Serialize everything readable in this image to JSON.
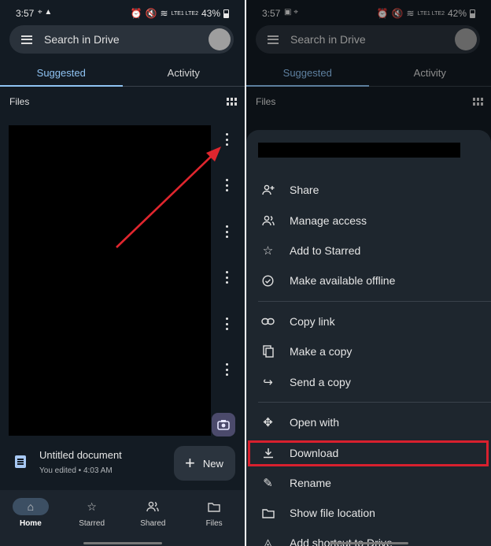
{
  "left": {
    "status": {
      "time": "3:57",
      "battery": "43%",
      "signal_text": "LTE1 LTE2"
    },
    "search": {
      "placeholder": "Search in Drive"
    },
    "tabs": [
      {
        "label": "Suggested",
        "active": true
      },
      {
        "label": "Activity",
        "active": false
      }
    ],
    "files_label": "Files",
    "recent_doc": {
      "title": "Untitled document",
      "subtitle": "You edited • 4:03 AM"
    },
    "fab_label": "New",
    "nav": [
      {
        "label": "Home",
        "icon": "home-icon",
        "active": true
      },
      {
        "label": "Starred",
        "icon": "star-icon",
        "active": false
      },
      {
        "label": "Shared",
        "icon": "shared-icon",
        "active": false
      },
      {
        "label": "Files",
        "icon": "folder-icon",
        "active": false
      }
    ]
  },
  "right": {
    "status": {
      "time": "3:57",
      "battery": "42%",
      "signal_text": "LTE1 LTE2"
    },
    "search": {
      "placeholder": "Search in Drive"
    },
    "tabs": [
      {
        "label": "Suggested",
        "active": true
      },
      {
        "label": "Activity",
        "active": false
      }
    ],
    "files_label": "Files",
    "menu": [
      {
        "label": "Share",
        "icon": "add-person-icon"
      },
      {
        "label": "Manage access",
        "icon": "people-icon"
      },
      {
        "label": "Add to Starred",
        "icon": "star-icon"
      },
      {
        "label": "Make available offline",
        "icon": "offline-icon"
      },
      {
        "label": "Copy link",
        "icon": "link-icon"
      },
      {
        "label": "Make a copy",
        "icon": "copy-icon"
      },
      {
        "label": "Send a copy",
        "icon": "send-icon"
      },
      {
        "label": "Open with",
        "icon": "open-with-icon"
      },
      {
        "label": "Download",
        "icon": "download-icon",
        "highlighted": true
      },
      {
        "label": "Rename",
        "icon": "edit-icon"
      },
      {
        "label": "Show file location",
        "icon": "folder-icon"
      },
      {
        "label": "Add shortcut to Drive",
        "icon": "shortcut-icon"
      }
    ]
  },
  "colors": {
    "background": "#131b23",
    "accent": "#8fc3f3",
    "highlight_box": "#d8202e",
    "annotation_arrow": "#e0262e"
  }
}
